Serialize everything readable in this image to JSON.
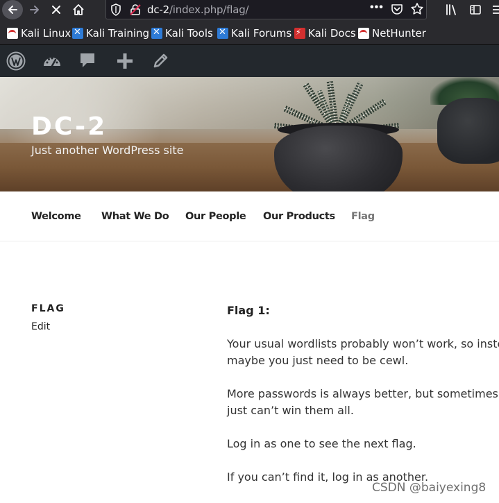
{
  "browser": {
    "url_host": "dc-2",
    "url_path": "/index.php/flag/",
    "more_label": "•••"
  },
  "bookmarks": [
    {
      "label": "Kali Linux",
      "icon": "kali-icon"
    },
    {
      "label": "Kali Training",
      "icon": "kali-training-icon"
    },
    {
      "label": "Kali Tools",
      "icon": "kali-tools-icon"
    },
    {
      "label": "Kali Forums",
      "icon": "kali-forums-icon"
    },
    {
      "label": "Kali Docs",
      "icon": "kali-docs-icon"
    },
    {
      "label": "NetHunter",
      "icon": "nethunter-icon"
    }
  ],
  "site": {
    "title": "DC-2",
    "description": "Just another WordPress site"
  },
  "nav": [
    {
      "label": "Welcome"
    },
    {
      "label": "What We Do"
    },
    {
      "label": "Our People"
    },
    {
      "label": "Our Products"
    },
    {
      "label": "Flag",
      "current": true
    }
  ],
  "page": {
    "title": "FLAG",
    "edit_label": "Edit"
  },
  "content": {
    "heading": "Flag 1:",
    "p1_line1": "Your usual wordlists probably won’t work, so instead,",
    "p1_line2": "maybe you just need to be cewl.",
    "p2_line1": "More passwords is always better, but sometimes you",
    "p2_line2": "just can’t win them all.",
    "p3": "Log in as one to see the next flag.",
    "p4": "If you can’t find it, log in as another."
  },
  "watermark": "CSDN @baiyexing8",
  "colors": {
    "browser_chrome": "#2a2a2e",
    "admin_bar": "#23282d",
    "nav_current": "#767676"
  }
}
